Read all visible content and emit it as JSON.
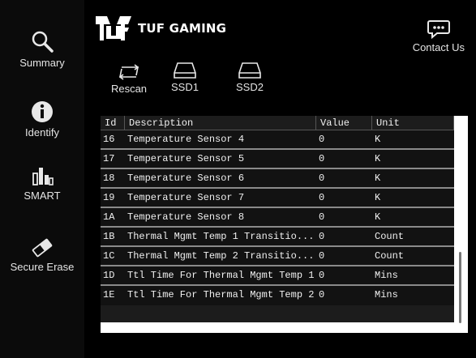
{
  "sidebar": {
    "items": [
      {
        "label": "Summary",
        "icon": "search-icon"
      },
      {
        "label": "Identify",
        "icon": "info-icon"
      },
      {
        "label": "SMART",
        "icon": "bar-chart-icon"
      },
      {
        "label": "Secure Erase",
        "icon": "eraser-icon"
      }
    ]
  },
  "header": {
    "brand": "TUF GAMING",
    "contact_label": "Contact Us"
  },
  "toolbar": {
    "rescan_label": "Rescan",
    "ssd1_label": "SSD1",
    "ssd2_label": "SSD2"
  },
  "table": {
    "columns": [
      "Id",
      "Description",
      "Value",
      "Unit"
    ],
    "rows": [
      {
        "id": "16",
        "description": "Temperature Sensor 4",
        "value": "0",
        "unit": "K"
      },
      {
        "id": "17",
        "description": "Temperature Sensor 5",
        "value": "0",
        "unit": "K"
      },
      {
        "id": "18",
        "description": "Temperature Sensor 6",
        "value": "0",
        "unit": "K"
      },
      {
        "id": "19",
        "description": "Temperature Sensor 7",
        "value": "0",
        "unit": "K"
      },
      {
        "id": "1A",
        "description": "Temperature Sensor 8",
        "value": "0",
        "unit": "K"
      },
      {
        "id": "1B",
        "description": "Thermal Mgmt Temp 1 Transitio...",
        "value": "0",
        "unit": "Count"
      },
      {
        "id": "1C",
        "description": "Thermal Mgmt Temp 2 Transitio...",
        "value": "0",
        "unit": "Count"
      },
      {
        "id": "1D",
        "description": "Ttl Time For Thermal Mgmt Temp 1",
        "value": "0",
        "unit": "Mins"
      },
      {
        "id": "1E",
        "description": "Ttl Time For Thermal Mgmt Temp 2",
        "value": "0",
        "unit": "Mins"
      }
    ]
  },
  "colors": {
    "background": "#000000",
    "sidebar": "#0b0b0b",
    "row_bg": "#121212",
    "row_separator": "#8a8a8a",
    "text": "#e8e8e8"
  }
}
